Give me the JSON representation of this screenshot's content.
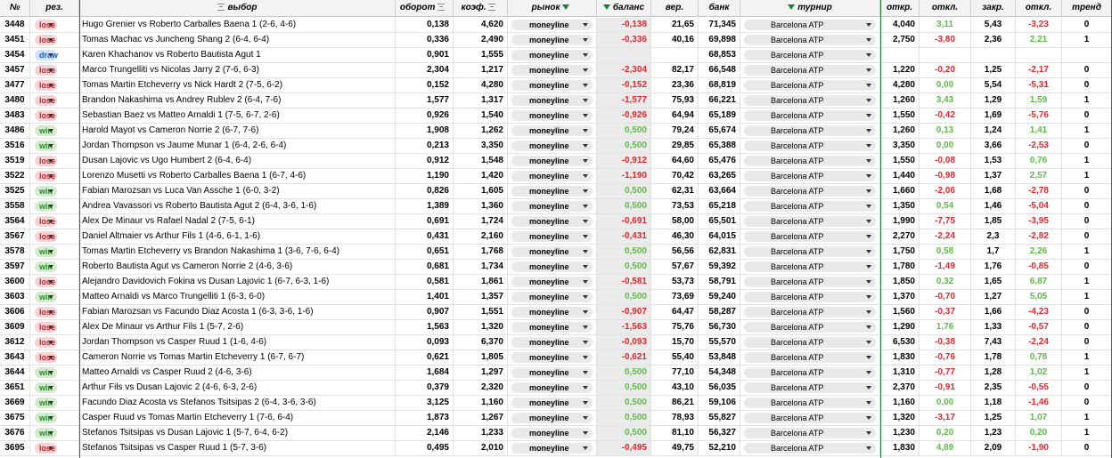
{
  "colors": {
    "negative": "#e8252a",
    "positive": "#5fb94a",
    "lose_bg": "#f7d3d4",
    "win_bg": "#d4ebcd",
    "draw_bg": "#d3e2f7",
    "header_bg": "#f3f3f3"
  },
  "icons": {
    "filter": "filter-lines-icon",
    "active_filter": "funnel-icon",
    "dropdown": "chevron-down-icon"
  },
  "header": {
    "id": "№",
    "result": "рез.",
    "pick": "выбор",
    "turnover": "оборот",
    "odds": "коэф.",
    "market": "рынок",
    "balance": "баланс",
    "prob": "вер.",
    "bank": "банк",
    "tournament": "турнир",
    "open": "откр.",
    "dev1": "откл.",
    "close": "закр.",
    "dev2": "откл.",
    "trend": "тренд"
  },
  "rows": [
    {
      "id": "3448",
      "result": "lose",
      "pick": "Hugo Grenier vs Roberto Carballes Baena 1 (2-6, 4-6)",
      "turnover": "0,138",
      "odds": "4,620",
      "market": "moneyline",
      "balance": "-0,138",
      "prob": "21,65",
      "bank": "71,345",
      "tournament": "Barcelona ATP",
      "open": "4,040",
      "dev1": "3,11",
      "close": "5,43",
      "dev2": "-3,23",
      "trend": "0"
    },
    {
      "id": "3451",
      "result": "lose",
      "pick": "Tomas Machac vs Juncheng Shang 2 (6-4, 6-4)",
      "turnover": "0,336",
      "odds": "2,490",
      "market": "moneyline",
      "balance": "-0,336",
      "prob": "40,16",
      "bank": "69,898",
      "tournament": "Barcelona ATP",
      "open": "2,750",
      "dev1": "-3,80",
      "close": "2,36",
      "dev2": "2,21",
      "trend": "1"
    },
    {
      "id": "3454",
      "result": "draw",
      "pick": "Karen Khachanov vs Roberto Bautista Agut 1",
      "turnover": "0,901",
      "odds": "1,555",
      "market": "moneyline",
      "balance": "",
      "prob": "",
      "bank": "68,853",
      "tournament": "Barcelona ATP",
      "open": "",
      "dev1": "",
      "close": "",
      "dev2": "",
      "trend": ""
    },
    {
      "id": "3457",
      "result": "lose",
      "pick": "Marco Trungelliti vs Nicolas Jarry 2 (7-6, 6-3)",
      "turnover": "2,304",
      "odds": "1,217",
      "market": "moneyline",
      "balance": "-2,304",
      "prob": "82,17",
      "bank": "66,548",
      "tournament": "Barcelona ATP",
      "open": "1,220",
      "dev1": "-0,20",
      "close": "1,25",
      "dev2": "-2,17",
      "trend": "0"
    },
    {
      "id": "3477",
      "result": "lose",
      "pick": "Tomas Martin Etcheverry vs Nick Hardt 2 (7-5, 6-2)",
      "turnover": "0,152",
      "odds": "4,280",
      "market": "moneyline",
      "balance": "-0,152",
      "prob": "23,36",
      "bank": "68,819",
      "tournament": "Barcelona ATP",
      "open": "4,280",
      "dev1": "0,00",
      "close": "5,54",
      "dev2": "-5,31",
      "trend": "0"
    },
    {
      "id": "3480",
      "result": "lose",
      "pick": "Brandon Nakashima vs Andrey Rublev 2 (6-4, 7-6)",
      "turnover": "1,577",
      "odds": "1,317",
      "market": "moneyline",
      "balance": "-1,577",
      "prob": "75,93",
      "bank": "66,221",
      "tournament": "Barcelona ATP",
      "open": "1,260",
      "dev1": "3,43",
      "close": "1,29",
      "dev2": "1,59",
      "trend": "1"
    },
    {
      "id": "3483",
      "result": "lose",
      "pick": "Sebastian Baez vs Matteo Arnaldi 1 (7-5, 6-7, 2-6)",
      "turnover": "0,926",
      "odds": "1,540",
      "market": "moneyline",
      "balance": "-0,926",
      "prob": "64,94",
      "bank": "65,189",
      "tournament": "Barcelona ATP",
      "open": "1,550",
      "dev1": "-0,42",
      "close": "1,69",
      "dev2": "-5,76",
      "trend": "0"
    },
    {
      "id": "3486",
      "result": "win",
      "pick": "Harold Mayot vs Cameron Norrie 2 (6-7, 7-6)",
      "turnover": "1,908",
      "odds": "1,262",
      "market": "moneyline",
      "balance": "0,500",
      "prob": "79,24",
      "bank": "65,674",
      "tournament": "Barcelona ATP",
      "open": "1,260",
      "dev1": "0,13",
      "close": "1,24",
      "dev2": "1,41",
      "trend": "1"
    },
    {
      "id": "3516",
      "result": "win",
      "pick": "Jordan Thompson vs Jaume Munar 1 (6-4, 2-6, 6-4)",
      "turnover": "0,213",
      "odds": "3,350",
      "market": "moneyline",
      "balance": "0,500",
      "prob": "29,85",
      "bank": "65,388",
      "tournament": "Barcelona ATP",
      "open": "3,350",
      "dev1": "0,00",
      "close": "3,66",
      "dev2": "-2,53",
      "trend": "0"
    },
    {
      "id": "3519",
      "result": "lose",
      "pick": "Dusan Lajovic vs Ugo Humbert 2 (6-4, 6-4)",
      "turnover": "0,912",
      "odds": "1,548",
      "market": "moneyline",
      "balance": "-0,912",
      "prob": "64,60",
      "bank": "65,476",
      "tournament": "Barcelona ATP",
      "open": "1,550",
      "dev1": "-0,08",
      "close": "1,53",
      "dev2": "0,76",
      "trend": "1"
    },
    {
      "id": "3522",
      "result": "lose",
      "pick": "Lorenzo Musetti vs Roberto Carballes Baena 1 (6-7, 4-6)",
      "turnover": "1,190",
      "odds": "1,420",
      "market": "moneyline",
      "balance": "-1,190",
      "prob": "70,42",
      "bank": "63,265",
      "tournament": "Barcelona ATP",
      "open": "1,440",
      "dev1": "-0,98",
      "close": "1,37",
      "dev2": "2,57",
      "trend": "1"
    },
    {
      "id": "3525",
      "result": "win",
      "pick": "Fabian Marozsan vs Luca Van Assche 1 (6-0, 3-2)",
      "turnover": "0,826",
      "odds": "1,605",
      "market": "moneyline",
      "balance": "0,500",
      "prob": "62,31",
      "bank": "63,664",
      "tournament": "Barcelona ATP",
      "open": "1,660",
      "dev1": "-2,06",
      "close": "1,68",
      "dev2": "-2,78",
      "trend": "0"
    },
    {
      "id": "3558",
      "result": "win",
      "pick": "Andrea Vavassori vs Roberto Bautista Agut 2 (6-4, 3-6, 1-6)",
      "turnover": "1,389",
      "odds": "1,360",
      "market": "moneyline",
      "balance": "0,500",
      "prob": "73,53",
      "bank": "65,218",
      "tournament": "Barcelona ATP",
      "open": "1,350",
      "dev1": "0,54",
      "close": "1,46",
      "dev2": "-5,04",
      "trend": "0"
    },
    {
      "id": "3564",
      "result": "lose",
      "pick": "Alex De Minaur vs Rafael Nadal 2 (7-5, 6-1)",
      "turnover": "0,691",
      "odds": "1,724",
      "market": "moneyline",
      "balance": "-0,691",
      "prob": "58,00",
      "bank": "65,501",
      "tournament": "Barcelona ATP",
      "open": "1,990",
      "dev1": "-7,75",
      "close": "1,85",
      "dev2": "-3,95",
      "trend": "0"
    },
    {
      "id": "3567",
      "result": "lose",
      "pick": "Daniel Altmaier vs Arthur Fils 1 (4-6, 6-1, 1-6)",
      "turnover": "0,431",
      "odds": "2,160",
      "market": "moneyline",
      "balance": "-0,431",
      "prob": "46,30",
      "bank": "64,015",
      "tournament": "Barcelona ATP",
      "open": "2,270",
      "dev1": "-2,24",
      "close": "2,3",
      "dev2": "-2,82",
      "trend": "0"
    },
    {
      "id": "3578",
      "result": "win",
      "pick": "Tomas Martin Etcheverry vs Brandon Nakashima 1 (3-6, 7-6, 6-4)",
      "turnover": "0,651",
      "odds": "1,768",
      "market": "moneyline",
      "balance": "0,500",
      "prob": "56,56",
      "bank": "62,831",
      "tournament": "Barcelona ATP",
      "open": "1,750",
      "dev1": "0,58",
      "close": "1,7",
      "dev2": "2,26",
      "trend": "1"
    },
    {
      "id": "3597",
      "result": "win",
      "pick": "Roberto Bautista Agut vs Cameron Norrie 2 (4-6, 3-6)",
      "turnover": "0,681",
      "odds": "1,734",
      "market": "moneyline",
      "balance": "0,500",
      "prob": "57,67",
      "bank": "59,392",
      "tournament": "Barcelona ATP",
      "open": "1,780",
      "dev1": "-1,49",
      "close": "1,76",
      "dev2": "-0,85",
      "trend": "0"
    },
    {
      "id": "3600",
      "result": "lose",
      "pick": "Alejandro Davidovich Fokina vs Dusan Lajovic 1 (6-7, 6-3, 1-6)",
      "turnover": "0,581",
      "odds": "1,861",
      "market": "moneyline",
      "balance": "-0,581",
      "prob": "53,73",
      "bank": "58,791",
      "tournament": "Barcelona ATP",
      "open": "1,850",
      "dev1": "0,32",
      "close": "1,65",
      "dev2": "6,87",
      "trend": "1"
    },
    {
      "id": "3603",
      "result": "win",
      "pick": "Matteo Arnaldi vs Marco Trungelliti 1 (6-3, 6-0)",
      "turnover": "1,401",
      "odds": "1,357",
      "market": "moneyline",
      "balance": "0,500",
      "prob": "73,69",
      "bank": "59,240",
      "tournament": "Barcelona ATP",
      "open": "1,370",
      "dev1": "-0,70",
      "close": "1,27",
      "dev2": "5,05",
      "trend": "1"
    },
    {
      "id": "3606",
      "result": "lose",
      "pick": "Fabian Marozsan vs Facundo Diaz Acosta 1 (6-3, 3-6, 1-6)",
      "turnover": "0,907",
      "odds": "1,551",
      "market": "moneyline",
      "balance": "-0,907",
      "prob": "64,47",
      "bank": "58,287",
      "tournament": "Barcelona ATP",
      "open": "1,560",
      "dev1": "-0,37",
      "close": "1,66",
      "dev2": "-4,23",
      "trend": "0"
    },
    {
      "id": "3609",
      "result": "lose",
      "pick": "Alex De Minaur vs Arthur Fils 1 (5-7, 2-6)",
      "turnover": "1,563",
      "odds": "1,320",
      "market": "moneyline",
      "balance": "-1,563",
      "prob": "75,76",
      "bank": "56,730",
      "tournament": "Barcelona ATP",
      "open": "1,290",
      "dev1": "1,76",
      "close": "1,33",
      "dev2": "-0,57",
      "trend": "0"
    },
    {
      "id": "3612",
      "result": "lose",
      "pick": "Jordan Thompson vs Casper Ruud 1 (1-6, 4-6)",
      "turnover": "0,093",
      "odds": "6,370",
      "market": "moneyline",
      "balance": "-0,093",
      "prob": "15,70",
      "bank": "55,570",
      "tournament": "Barcelona ATP",
      "open": "6,530",
      "dev1": "-0,38",
      "close": "7,43",
      "dev2": "-2,24",
      "trend": "0"
    },
    {
      "id": "3643",
      "result": "lose",
      "pick": "Cameron Norrie vs Tomas Martin Etcheverry 1 (6-7, 6-7)",
      "turnover": "0,621",
      "odds": "1,805",
      "market": "moneyline",
      "balance": "-0,621",
      "prob": "55,40",
      "bank": "53,848",
      "tournament": "Barcelona ATP",
      "open": "1,830",
      "dev1": "-0,76",
      "close": "1,78",
      "dev2": "0,78",
      "trend": "1"
    },
    {
      "id": "3644",
      "result": "win",
      "pick": "Matteo Arnaldi vs Casper Ruud 2 (4-6, 3-6)",
      "turnover": "1,684",
      "odds": "1,297",
      "market": "moneyline",
      "balance": "0,500",
      "prob": "77,10",
      "bank": "54,348",
      "tournament": "Barcelona ATP",
      "open": "1,310",
      "dev1": "-0,77",
      "close": "1,28",
      "dev2": "1,02",
      "trend": "1"
    },
    {
      "id": "3651",
      "result": "win",
      "pick": "Arthur Fils vs Dusan Lajovic 2 (4-6, 6-3, 2-6)",
      "turnover": "0,379",
      "odds": "2,320",
      "market": "moneyline",
      "balance": "0,500",
      "prob": "43,10",
      "bank": "56,035",
      "tournament": "Barcelona ATP",
      "open": "2,370",
      "dev1": "-0,91",
      "close": "2,35",
      "dev2": "-0,55",
      "trend": "0"
    },
    {
      "id": "3669",
      "result": "win",
      "pick": "Facundo Diaz Acosta vs Stefanos Tsitsipas 2 (6-4, 3-6, 3-6)",
      "turnover": "3,125",
      "odds": "1,160",
      "market": "moneyline",
      "balance": "0,500",
      "prob": "86,21",
      "bank": "59,106",
      "tournament": "Barcelona ATP",
      "open": "1,160",
      "dev1": "0,00",
      "close": "1,18",
      "dev2": "-1,46",
      "trend": "0"
    },
    {
      "id": "3675",
      "result": "win",
      "pick": "Casper Ruud vs Tomas Martin Etcheverry 1 (7-6, 6-4)",
      "turnover": "1,873",
      "odds": "1,267",
      "market": "moneyline",
      "balance": "0,500",
      "prob": "78,93",
      "bank": "55,827",
      "tournament": "Barcelona ATP",
      "open": "1,320",
      "dev1": "-3,17",
      "close": "1,25",
      "dev2": "1,07",
      "trend": "1"
    },
    {
      "id": "3676",
      "result": "win",
      "pick": "Stefanos Tsitsipas vs Dusan Lajovic 1 (5-7, 6-4, 6-2)",
      "turnover": "2,146",
      "odds": "1,233",
      "market": "moneyline",
      "balance": "0,500",
      "prob": "81,10",
      "bank": "56,327",
      "tournament": "Barcelona ATP",
      "open": "1,230",
      "dev1": "0,20",
      "close": "1,23",
      "dev2": "0,20",
      "trend": "1"
    },
    {
      "id": "3695",
      "result": "lose",
      "pick": "Stefanos Tsitsipas vs Casper Ruud 1 (5-7, 3-6)",
      "turnover": "0,495",
      "odds": "2,010",
      "market": "moneyline",
      "balance": "-0,495",
      "prob": "49,75",
      "bank": "52,210",
      "tournament": "Barcelona ATP",
      "open": "1,830",
      "dev1": "4,89",
      "close": "2,09",
      "dev2": "-1,90",
      "trend": "0"
    }
  ]
}
